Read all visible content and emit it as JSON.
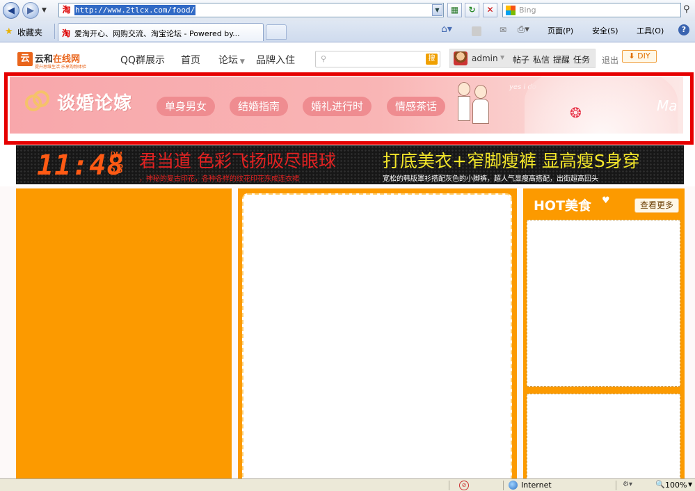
{
  "browser": {
    "address": "http://www.2tlcx.com/food/",
    "search_placeholder": "Bing",
    "favorites_label": "收藏夹",
    "tab_title": "爱淘开心、网购交流、淘宝论坛 - Powered by...",
    "commands": {
      "page": "页面(P)",
      "safety": "安全(S)",
      "tools": "工具(O)"
    }
  },
  "site": {
    "logo": {
      "mark": "云",
      "name_plain": "云和",
      "name_highlight": "在线网",
      "tagline": "提升思维生活 乐享购物体验"
    },
    "nav": [
      "QQ群展示",
      "首页",
      "论坛",
      "品牌入住"
    ],
    "search_button": "搜",
    "user": {
      "name": "admin",
      "links": [
        "帖子",
        "私信",
        "提醒",
        "任务"
      ],
      "logout": "退出",
      "diy": "DIY"
    }
  },
  "banner": {
    "title": "谈婚论嫁",
    "nav": [
      "单身男女",
      "结婚指南",
      "婚礼进行时",
      "情感茶话"
    ],
    "script_text": "yes i do",
    "corner_text": "Ma"
  },
  "ad_strip": {
    "time": "11:48",
    "ampm": "PM",
    "seconds": "53",
    "ad1_headline": "君当道 色彩飞扬吸尽眼球",
    "ad1_sub": "，神秘的复古印花，各种各样的纹花印花东成连衣裙",
    "ad2_headline": "打底美衣+窄脚瘦裤 显高瘦S身穿",
    "ad2_sub": "宽松的韩版罩衫搭配灰色的小脚裤，超人气显瘦高搭配，出街超高回头"
  },
  "hot": {
    "title": "HOT美食",
    "more": "查看更多"
  },
  "statusbar": {
    "zone": "Internet",
    "zoom": "100%"
  },
  "colors": {
    "orange": "#fc9a00",
    "banner_pink": "#f8a7ab",
    "highlight_red": "#e60000"
  }
}
